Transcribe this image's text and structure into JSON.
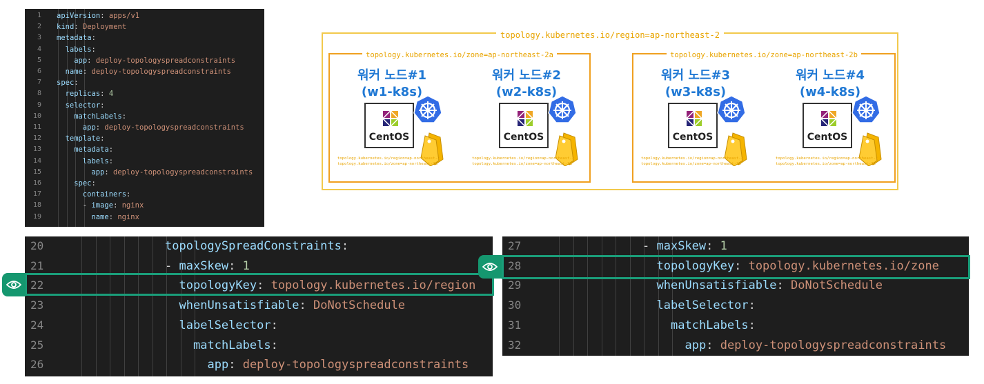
{
  "top_code": {
    "lines": [
      {
        "n": "1",
        "indent": 0,
        "key": "apiVersion",
        "val": "apps/v1"
      },
      {
        "n": "2",
        "indent": 0,
        "key": "kind",
        "val": "Deployment"
      },
      {
        "n": "3",
        "indent": 0,
        "key": "metadata",
        "val": ""
      },
      {
        "n": "4",
        "indent": 1,
        "key": "labels",
        "val": ""
      },
      {
        "n": "5",
        "indent": 2,
        "key": "app",
        "val": "deploy-topologyspreadconstraints"
      },
      {
        "n": "6",
        "indent": 1,
        "key": "name",
        "val": "deploy-topologyspreadconstraints"
      },
      {
        "n": "7",
        "indent": 0,
        "key": "spec",
        "val": ""
      },
      {
        "n": "8",
        "indent": 1,
        "key": "replicas",
        "val": "4",
        "num": true
      },
      {
        "n": "9",
        "indent": 1,
        "key": "selector",
        "val": ""
      },
      {
        "n": "10",
        "indent": 2,
        "key": "matchLabels",
        "val": ""
      },
      {
        "n": "11",
        "indent": 3,
        "key": "app",
        "val": "deploy-topologyspreadconstraints"
      },
      {
        "n": "12",
        "indent": 1,
        "key": "template",
        "val": ""
      },
      {
        "n": "13",
        "indent": 2,
        "key": "metadata",
        "val": ""
      },
      {
        "n": "14",
        "indent": 3,
        "key": "labels",
        "val": ""
      },
      {
        "n": "15",
        "indent": 4,
        "key": "app",
        "val": "deploy-topologyspreadconstraints"
      },
      {
        "n": "16",
        "indent": 2,
        "key": "spec",
        "val": ""
      },
      {
        "n": "17",
        "indent": 3,
        "key": "containers",
        "val": ""
      },
      {
        "n": "18",
        "indent": 3,
        "dash": true,
        "key": "image",
        "val": "nginx"
      },
      {
        "n": "19",
        "indent": 4,
        "key": "name",
        "val": "nginx"
      }
    ]
  },
  "bottom_left_code": {
    "lines": [
      {
        "n": "20",
        "indent": 6,
        "key": "topologySpreadConstraints",
        "val": ""
      },
      {
        "n": "21",
        "indent": 6,
        "dash": true,
        "key": "maxSkew",
        "val": "1",
        "num": true
      },
      {
        "n": "22",
        "indent": 7,
        "key": "topologyKey",
        "val": "topology.kubernetes.io/region"
      },
      {
        "n": "23",
        "indent": 7,
        "key": "whenUnsatisfiable",
        "val": "DoNotSchedule"
      },
      {
        "n": "24",
        "indent": 7,
        "key": "labelSelector",
        "val": ""
      },
      {
        "n": "25",
        "indent": 8,
        "key": "matchLabels",
        "val": ""
      },
      {
        "n": "26",
        "indent": 9,
        "key": "app",
        "val": "deploy-topologyspreadconstraints"
      }
    ]
  },
  "bottom_right_code": {
    "lines": [
      {
        "n": "27",
        "indent": 6,
        "dash": true,
        "key": "maxSkew",
        "val": "1",
        "num": true
      },
      {
        "n": "28",
        "indent": 7,
        "key": "topologyKey",
        "val": "topology.kubernetes.io/zone"
      },
      {
        "n": "29",
        "indent": 7,
        "key": "whenUnsatisfiable",
        "val": "DoNotSchedule"
      },
      {
        "n": "30",
        "indent": 7,
        "key": "labelSelector",
        "val": ""
      },
      {
        "n": "31",
        "indent": 8,
        "key": "matchLabels",
        "val": ""
      },
      {
        "n": "32",
        "indent": 9,
        "key": "app",
        "val": "deploy-topologyspreadconstraints"
      }
    ]
  },
  "diagram": {
    "region_label": "topology.kubernetes.io/region=ap-northeast-2",
    "zones": [
      {
        "label": "topology.kubernetes.io/zone=ap-northeast-2a"
      },
      {
        "label": "topology.kubernetes.io/zone=ap-northeast-2b"
      }
    ],
    "nodes": [
      {
        "title": "워커 노드#1",
        "host": "(w1-k8s)",
        "os": "CentOS",
        "region_tag": "topology.kubernetes.io/region=ap-northeast-2",
        "zone_tag": "topology.kubernetes.io/zone=ap-northeast-2a"
      },
      {
        "title": "워커 노드#2",
        "host": "(w2-k8s)",
        "os": "CentOS",
        "region_tag": "topology.kubernetes.io/region=ap-northeast-2",
        "zone_tag": "topology.kubernetes.io/zone=ap-northeast-2a"
      },
      {
        "title": "워커 노드#3",
        "host": "(w3-k8s)",
        "os": "CentOS",
        "region_tag": "topology.kubernetes.io/region=ap-northeast-2",
        "zone_tag": "topology.kubernetes.io/zone=ap-northeast-2b"
      },
      {
        "title": "워커 노드#4",
        "host": "(w4-k8s)",
        "os": "CentOS",
        "region_tag": "topology.kubernetes.io/region=ap-northeast-2",
        "zone_tag": "topology.kubernetes.io/zone=ap-northeast-2b"
      }
    ]
  },
  "colors": {
    "highlight": "#1a9e7a",
    "region_border": "#f2c94c",
    "zone_border": "#f0a020",
    "node_title": "#1f78d4",
    "editor_bg": "#1e1e1e"
  },
  "icons": [
    "eye-icon",
    "kubernetes-icon",
    "centos-logo-icon",
    "tag-icon"
  ]
}
